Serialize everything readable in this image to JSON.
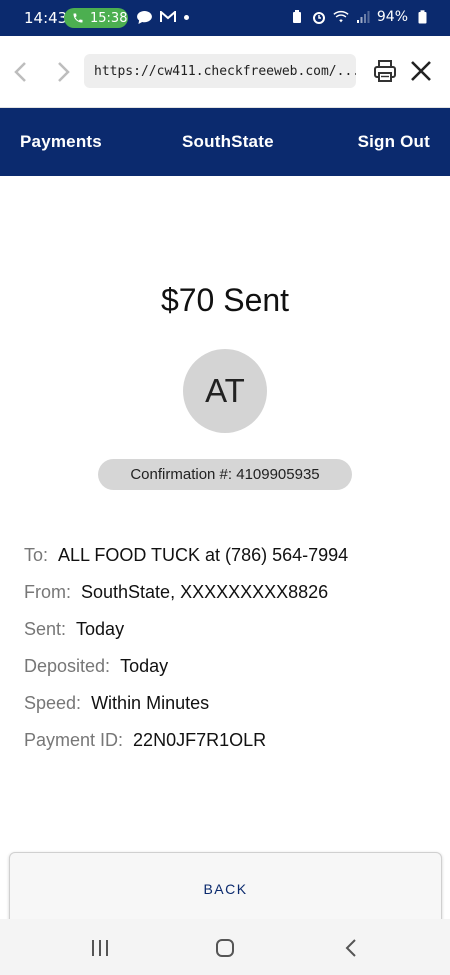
{
  "status_bar": {
    "time": "14:43",
    "call_timer": "15:38",
    "battery": "94%",
    "icons": [
      "phone-icon",
      "chat-icon",
      "gmail-icon",
      "battery-saver-icon",
      "alarm-icon",
      "wifi-icon",
      "signal-icon",
      "battery-icon"
    ]
  },
  "browser": {
    "url": "https://cw411.checkfreeweb.com/..."
  },
  "header": {
    "payments": "Payments",
    "bank": "SouthState",
    "sign_out": "Sign Out",
    "color": "#0b2a6e"
  },
  "payment": {
    "amount_status": "$70 Sent",
    "avatar_initials": "AT",
    "confirmation": "Confirmation #: 4109905935",
    "details": [
      {
        "label": "To:",
        "value": "ALL FOOD TUCK at (786) 564-7994"
      },
      {
        "label": "From:",
        "value": "SouthState, XXXXXXXXX8826"
      },
      {
        "label": "Sent:",
        "value": "Today"
      },
      {
        "label": "Deposited:",
        "value": "Today"
      },
      {
        "label": "Speed:",
        "value": "Within Minutes"
      },
      {
        "label": "Payment ID:",
        "value": "22N0JF7R1OLR"
      }
    ]
  },
  "back_button": "BACK"
}
